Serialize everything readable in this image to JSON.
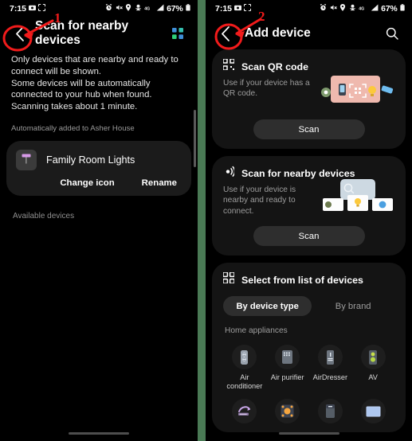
{
  "statusbar": {
    "time": "7:15",
    "battery": "67%",
    "icons_left": [
      "camera-icon",
      "screenshot-icon"
    ],
    "icons_right": [
      "alarm-icon",
      "mute-icon",
      "location-icon",
      "vpn-icon",
      "data-icon",
      "signal-icon"
    ]
  },
  "left_panel": {
    "header": {
      "back_label": "‹",
      "title": "Scan for nearby devices",
      "grid_icon": "apps-grid-icon"
    },
    "description_1": "Only devices that are nearby and ready to connect will be shown.",
    "description_2": "Some devices will be automatically connected to your hub when found. Scanning takes about 1 minute.",
    "auto_added_note": "Automatically added to Asher House",
    "device_card": {
      "name": "Family Room Lights",
      "change_icon_label": "Change icon",
      "rename_label": "Rename"
    },
    "available_devices_label": "Available devices"
  },
  "right_panel": {
    "header": {
      "back_label": "‹",
      "title": "Add device",
      "search_icon": "search-icon"
    },
    "cards": [
      {
        "icon": "qr-code-icon",
        "title": "Scan QR code",
        "subtitle": "Use if your device has a QR code.",
        "button": "Scan",
        "illustration": "qr-scan-illustration"
      },
      {
        "icon": "radar-icon",
        "title": "Scan for nearby devices",
        "subtitle": "Use if your device is nearby and ready to connect.",
        "button": "Scan",
        "illustration": "nearby-devices-illustration"
      }
    ],
    "list_card": {
      "icon": "grid-squares-icon",
      "title": "Select from list of devices",
      "tabs": [
        {
          "label": "By device type",
          "active": true
        },
        {
          "label": "By brand",
          "active": false
        }
      ],
      "section_label": "Home appliances",
      "devices": [
        {
          "label": "Air conditioner",
          "icon": "air-conditioner-icon"
        },
        {
          "label": "Air purifier",
          "icon": "air-purifier-icon"
        },
        {
          "label": "AirDresser",
          "icon": "airdresser-icon"
        },
        {
          "label": "AV",
          "icon": "av-icon"
        },
        {
          "label": "",
          "icon": "blu-ray-icon"
        },
        {
          "label": "",
          "icon": "cooktop-icon"
        },
        {
          "label": "",
          "icon": "dishwasher-icon"
        },
        {
          "label": "",
          "icon": "display-icon"
        }
      ]
    }
  },
  "annotations": [
    {
      "number": "1",
      "target": "left-back-button"
    },
    {
      "number": "2",
      "target": "right-back-button"
    }
  ],
  "colors": {
    "background": "#000000",
    "divider": "#4a7a55",
    "card": "#141414",
    "button": "#2e2e2e",
    "annotation": "#f11b1b",
    "accent_pink": "#efb9ae",
    "accent_blue": "#cdd9e2"
  }
}
